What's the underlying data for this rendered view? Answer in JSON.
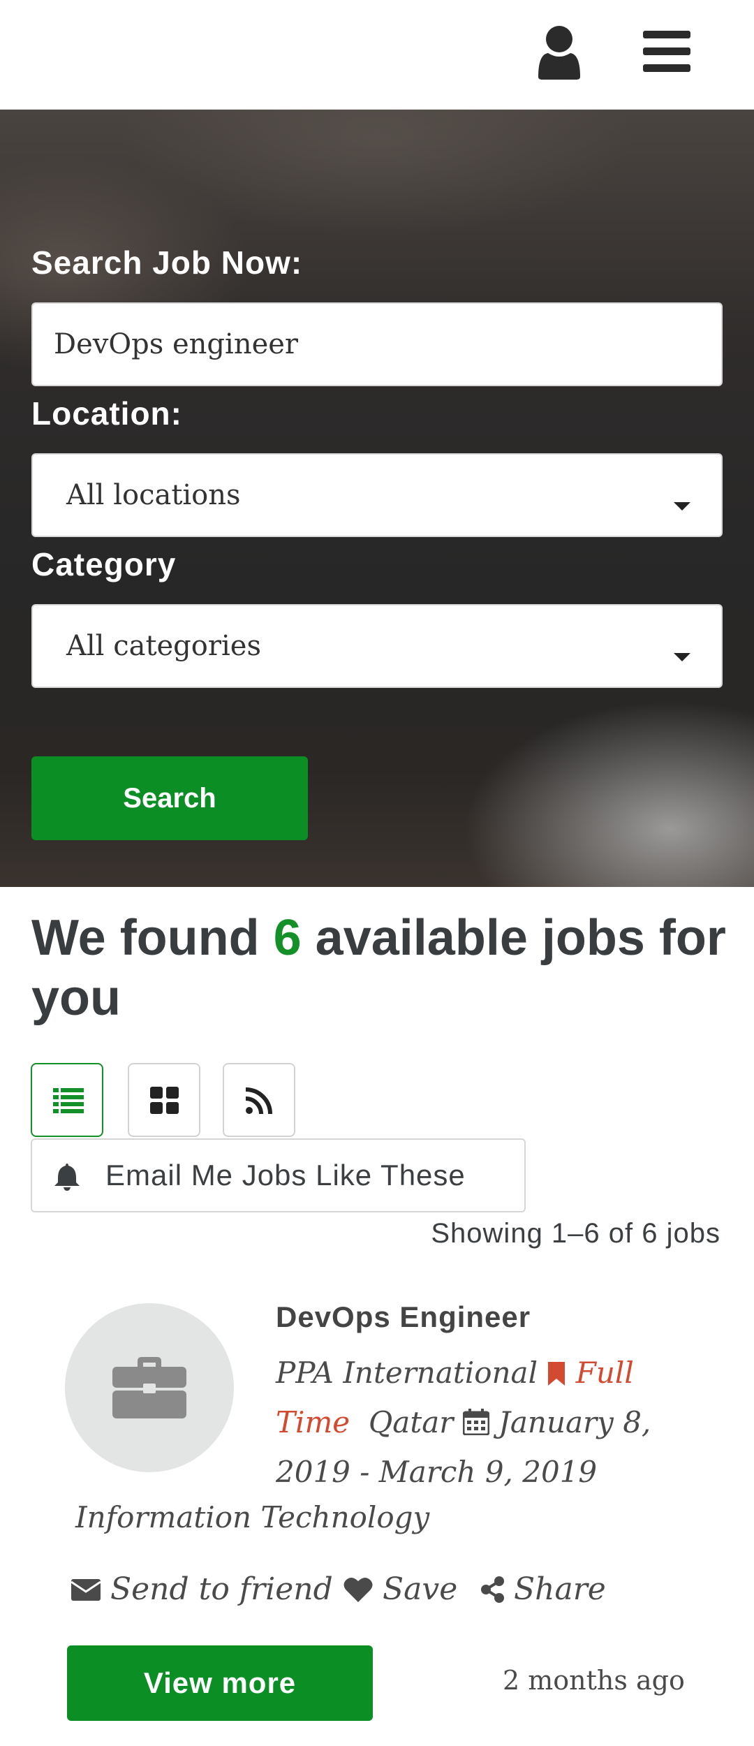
{
  "header": {
    "user_icon": "user-icon",
    "menu_icon": "hamburger-menu-icon"
  },
  "search_form": {
    "keyword_label": "Search Job Now:",
    "keyword_value": "DevOps engineer",
    "location_label": "Location:",
    "location_selected": "All locations",
    "category_label": "Category",
    "category_selected": "All categories",
    "search_button": "Search",
    "button_color": "#0b8f25"
  },
  "results": {
    "heading_prefix": "We found ",
    "count": "6",
    "heading_suffix": " available jobs for you",
    "count_color": "#149029",
    "view_modes": [
      "list-icon",
      "grid-icon",
      "rss-icon"
    ],
    "active_view": "list",
    "email_alert_label": "Email Me Jobs Like These",
    "showing_text": "Showing 1–6 of 6 jobs"
  },
  "jobs": [
    {
      "title": "DevOps Engineer",
      "company": "PPA International",
      "type": "Full Time",
      "type_color": "#d24a30",
      "location": "Qatar",
      "dates": "January 8, 2019 - March 9, 2019",
      "category": "Information Technology",
      "actions": {
        "send_to_friend": "Send to friend",
        "save": "Save",
        "share": "Share"
      },
      "view_more": "View more",
      "posted": "2 months ago"
    }
  ]
}
